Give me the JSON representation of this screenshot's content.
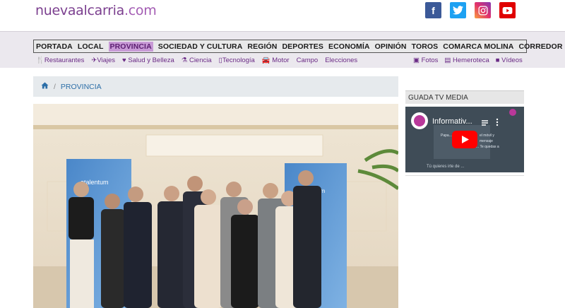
{
  "site": {
    "logo_part1": "nueva",
    "logo_part2": "alcarria",
    "logo_part3": ".com"
  },
  "social": [
    {
      "name": "facebook-icon",
      "glyph": "f"
    },
    {
      "name": "twitter-icon",
      "glyph": "t"
    },
    {
      "name": "instagram-icon",
      "glyph": "◎"
    },
    {
      "name": "youtube-icon",
      "glyph": "▶"
    }
  ],
  "mainnav": [
    "PORTADA",
    "LOCAL",
    "PROVINCIA",
    "SOCIEDAD Y CULTURA",
    "REGIÓN",
    "DEPORTES",
    "ECONOMÍA",
    "OPINIÓN",
    "TOROS",
    "COMARCA MOLINA",
    "CORREDOR"
  ],
  "mainnav_active": "PROVINCIA",
  "subnav": [
    "Restaurantes",
    "Viajes",
    "Salud y Belleza",
    "Ciencia",
    "Tecnología",
    "Motor",
    "Campo",
    "Elecciones"
  ],
  "subnav_right": [
    "Fotos",
    "Hemeroteca",
    "Vídeos"
  ],
  "breadcrumb": {
    "current": "PROVINCIA",
    "separator": "/"
  },
  "photo": {
    "banner_brand": "etalentum"
  },
  "sidebar": {
    "title": "GUADA TV MEDIA",
    "video_title": "Informativ...",
    "video_texts": [
      "Papa...",
      "el móvil y",
      "mensaje",
      "... Te quedas a",
      "Tú quieres irte de ..."
    ]
  },
  "colors": {
    "brand": "#7b3f8f",
    "active_nav": "#c89ad6",
    "link": "#2d6fa8"
  }
}
